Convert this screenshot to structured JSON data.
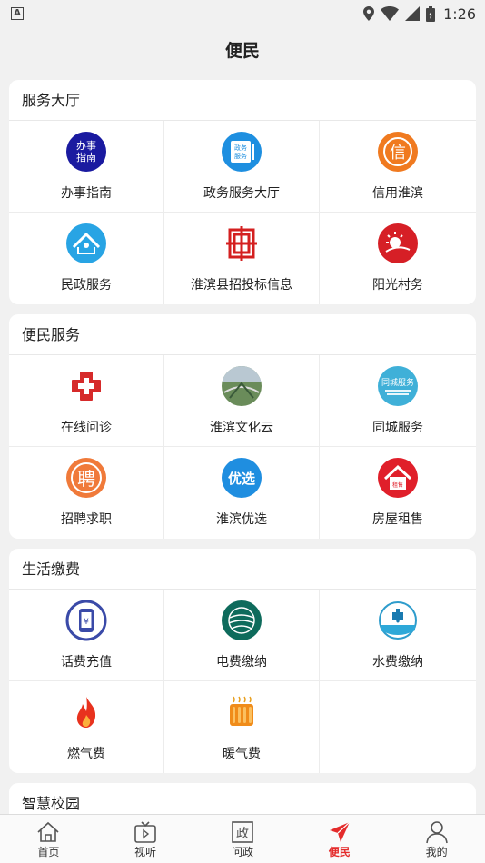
{
  "status_bar": {
    "time": "1:26",
    "notification_badge": "A"
  },
  "header": {
    "title": "便民"
  },
  "sections": [
    {
      "title": "服务大厅",
      "items": [
        {
          "label": "办事指南",
          "icon": "guide-icon"
        },
        {
          "label": "政务服务大厅",
          "icon": "government-service-icon"
        },
        {
          "label": "信用淮滨",
          "icon": "credit-icon"
        },
        {
          "label": "民政服务",
          "icon": "civil-affairs-icon"
        },
        {
          "label": "淮滨县招投标信息",
          "icon": "bidding-icon"
        },
        {
          "label": "阳光村务",
          "icon": "sunshine-village-icon"
        }
      ]
    },
    {
      "title": "便民服务",
      "items": [
        {
          "label": "在线问诊",
          "icon": "medical-cross-icon"
        },
        {
          "label": "淮滨文化云",
          "icon": "culture-cloud-icon"
        },
        {
          "label": "同城服务",
          "icon": "local-service-icon"
        },
        {
          "label": "招聘求职",
          "icon": "recruitment-icon"
        },
        {
          "label": "淮滨优选",
          "icon": "selection-icon"
        },
        {
          "label": "房屋租售",
          "icon": "house-rent-icon"
        }
      ]
    },
    {
      "title": "生活缴费",
      "items": [
        {
          "label": "话费充值",
          "icon": "phone-recharge-icon"
        },
        {
          "label": "电费缴纳",
          "icon": "electricity-icon"
        },
        {
          "label": "水费缴纳",
          "icon": "water-icon"
        },
        {
          "label": "燃气费",
          "icon": "gas-flame-icon"
        },
        {
          "label": "暖气费",
          "icon": "heater-icon"
        }
      ]
    },
    {
      "title": "智慧校园",
      "items": []
    }
  ],
  "icon_text": {
    "guide_line1": "办事",
    "guide_line2": "指南",
    "gov_line1": "政务",
    "gov_line2": "服务",
    "credit_char": "信",
    "recruit_char": "聘",
    "select_text": "优选",
    "local_text": "同城服务",
    "house_text": "租售",
    "tab_gov_char": "政"
  },
  "tabs": [
    {
      "label": "首页",
      "icon": "home-icon",
      "active": false
    },
    {
      "label": "视听",
      "icon": "tv-icon",
      "active": false
    },
    {
      "label": "问政",
      "icon": "inquiry-icon",
      "active": false
    },
    {
      "label": "便民",
      "icon": "send-icon",
      "active": true
    },
    {
      "label": "我的",
      "icon": "user-icon",
      "active": false
    }
  ],
  "colors": {
    "accent": "#e42b2b",
    "background": "#f1f1f1"
  }
}
